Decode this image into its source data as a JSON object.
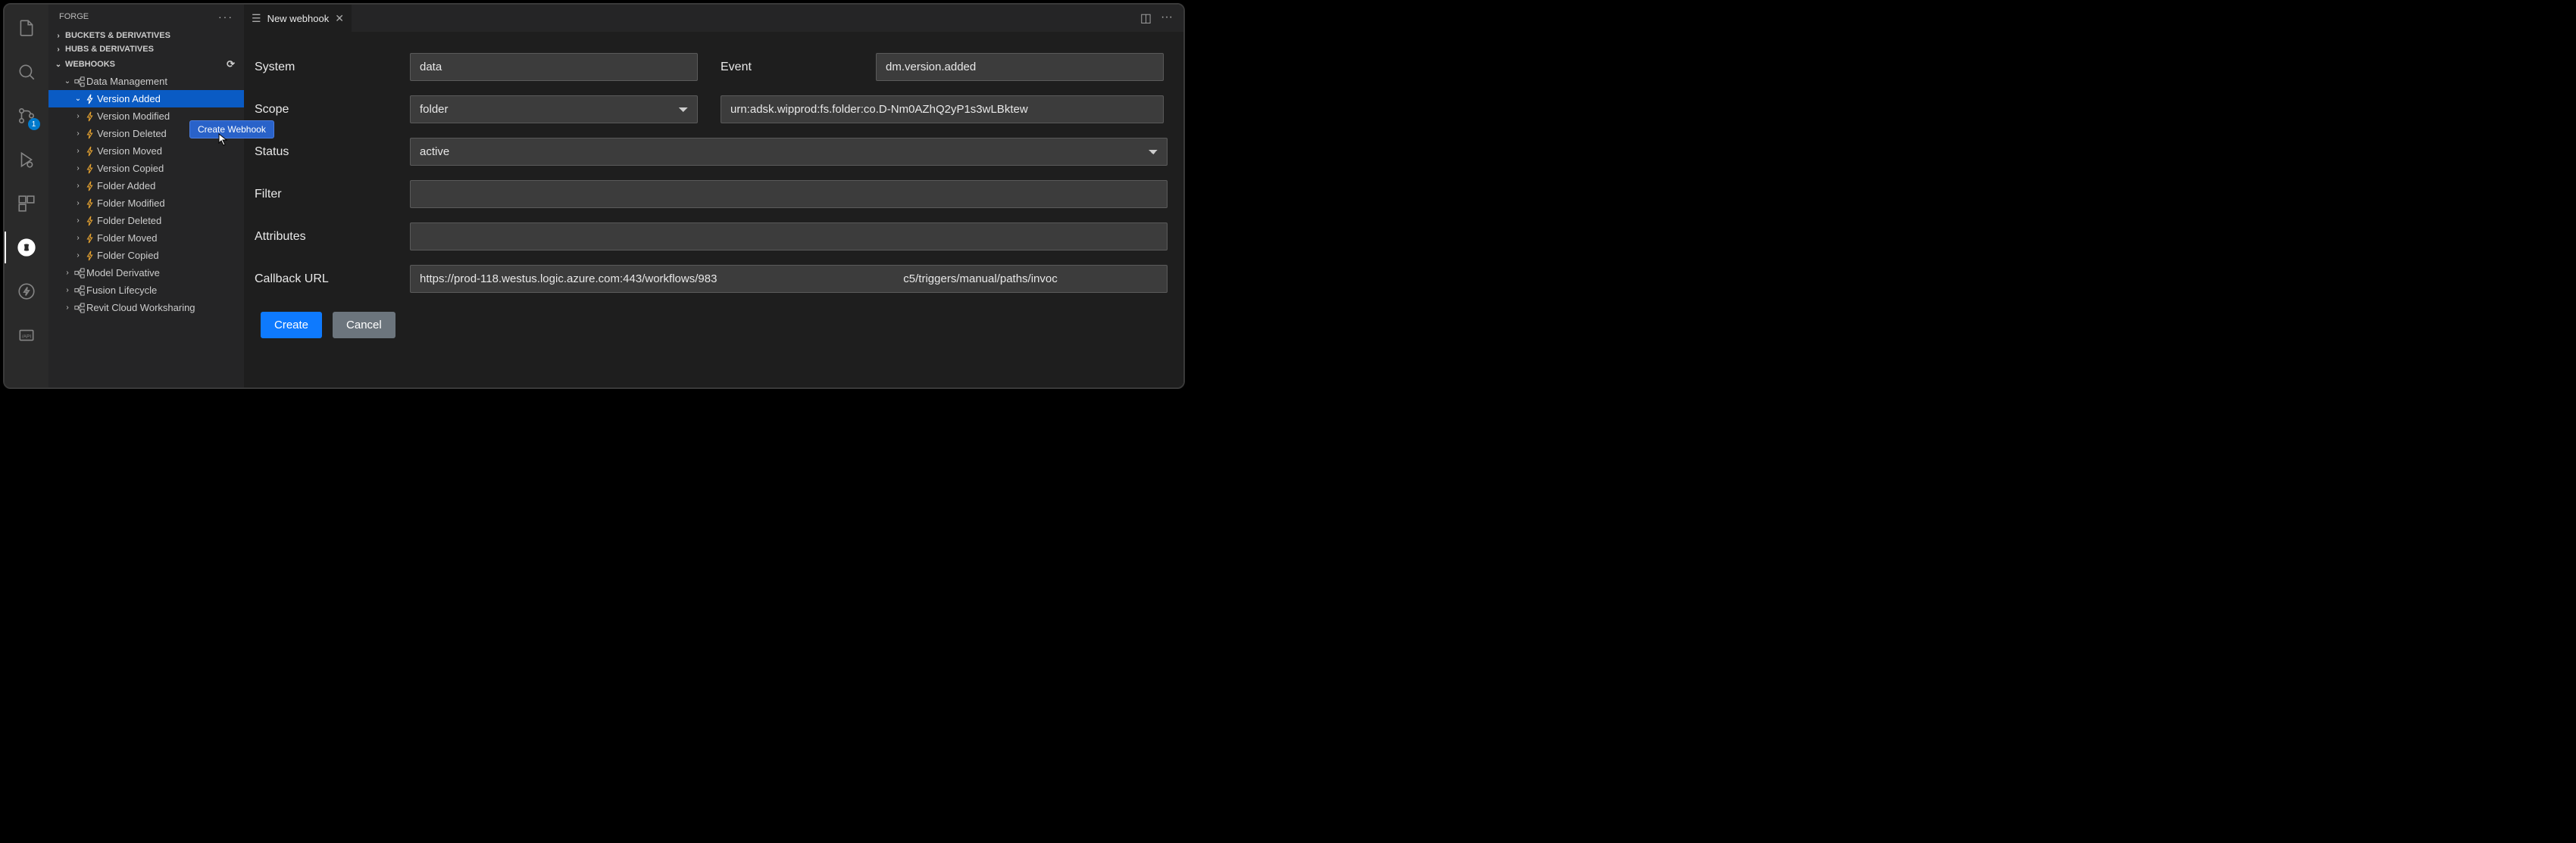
{
  "activityBar": {
    "scm_badge": "1"
  },
  "sidebar": {
    "title": "FORGE",
    "sections": {
      "buckets": "BUCKETS & DERIVATIVES",
      "hubs": "HUBS & DERIVATIVES",
      "webhooks": "WEBHOOKS"
    },
    "tree": {
      "dataManagement": "Data Management",
      "events": {
        "versionAdded": "Version Added",
        "versionModified": "Version Modified",
        "versionDeleted": "Version Deleted",
        "versionMoved": "Version Moved",
        "versionCopied": "Version Copied",
        "folderAdded": "Folder Added",
        "folderModified": "Folder Modified",
        "folderDeleted": "Folder Deleted",
        "folderMoved": "Folder Moved",
        "folderCopied": "Folder Copied"
      },
      "modelDerivative": "Model Derivative",
      "fusionLifecycle": "Fusion Lifecycle",
      "revitCloud": "Revit Cloud Worksharing"
    }
  },
  "tooltip": "Create Webhook",
  "tab": {
    "title": "New webhook"
  },
  "form": {
    "labels": {
      "system": "System",
      "event": "Event",
      "scope": "Scope",
      "status": "Status",
      "filter": "Filter",
      "attributes": "Attributes",
      "callback": "Callback URL"
    },
    "values": {
      "system": "data",
      "event": "dm.version.added",
      "scopeType": "folder",
      "scopeId": "urn:adsk.wipprod:fs.folder:co.D-Nm0AZhQ2yP1s3wLBktew",
      "status": "active",
      "filter": "",
      "attributes": "",
      "callback": "https://prod-118.westus.logic.azure.com:443/workflows/983                                                           c5/triggers/manual/paths/invoc"
    },
    "buttons": {
      "create": "Create",
      "cancel": "Cancel"
    }
  }
}
